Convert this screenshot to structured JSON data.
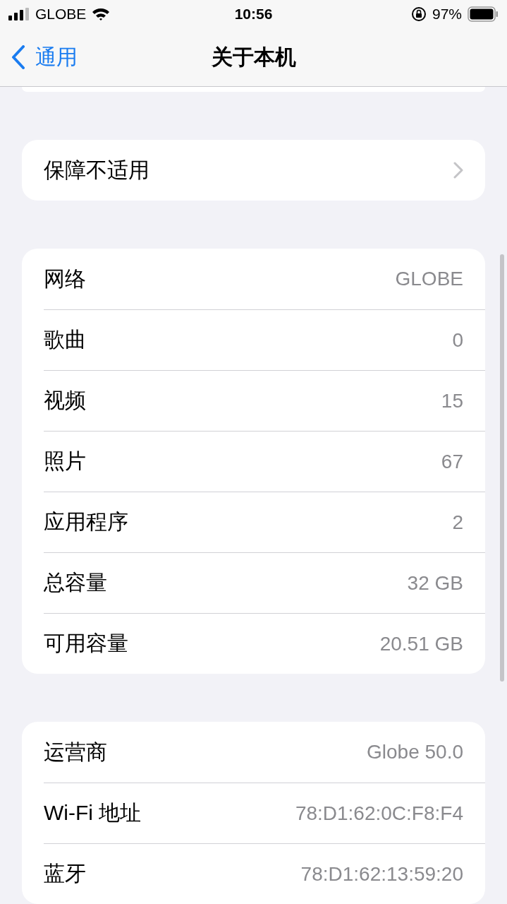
{
  "status_bar": {
    "carrier": "GLOBE",
    "time": "10:56",
    "battery": "97%"
  },
  "nav": {
    "back": "通用",
    "title": "关于本机"
  },
  "groups": [
    {
      "rows": [
        {
          "kind": "link",
          "label": "保障不适用"
        }
      ]
    },
    {
      "rows": [
        {
          "kind": "info",
          "label": "网络",
          "value": "GLOBE"
        },
        {
          "kind": "info",
          "label": "歌曲",
          "value": "0"
        },
        {
          "kind": "info",
          "label": "视频",
          "value": "15"
        },
        {
          "kind": "info",
          "label": "照片",
          "value": "67"
        },
        {
          "kind": "info",
          "label": "应用程序",
          "value": "2"
        },
        {
          "kind": "info",
          "label": "总容量",
          "value": "32 GB"
        },
        {
          "kind": "info",
          "label": "可用容量",
          "value": "20.51 GB"
        }
      ]
    },
    {
      "rows": [
        {
          "kind": "info",
          "label": "运营商",
          "value": "Globe 50.0"
        },
        {
          "kind": "info",
          "label": "Wi-Fi 地址",
          "value": "78:D1:62:0C:F8:F4"
        },
        {
          "kind": "info",
          "label": "蓝牙",
          "value": "78:D1:62:13:59:20"
        }
      ]
    }
  ]
}
